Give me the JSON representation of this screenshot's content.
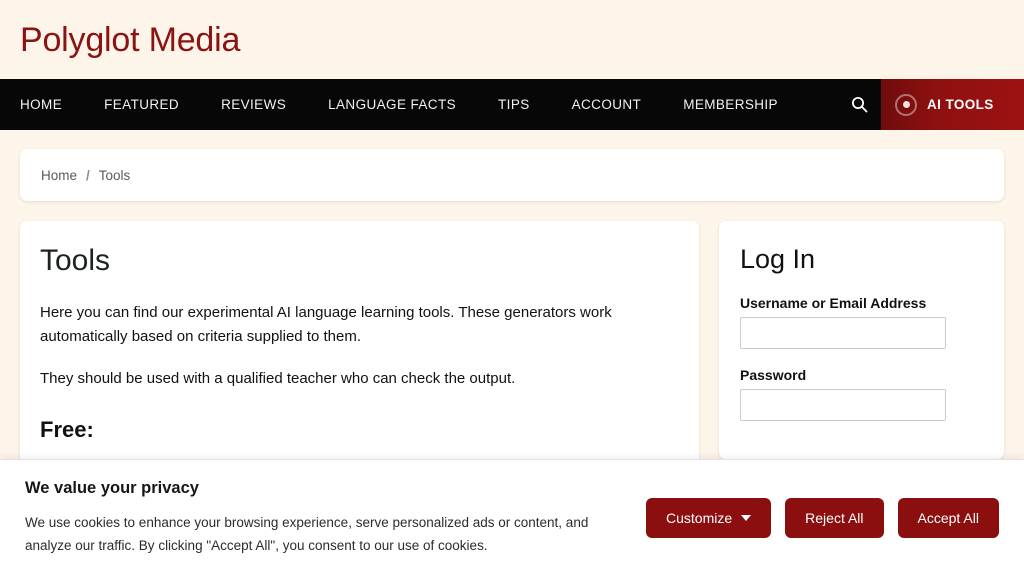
{
  "site": {
    "logo_text": "Polyglot Media",
    "logo_color": "#8b1313",
    "page_background": "#fdf4ea",
    "accent_color": "#8b0f0f"
  },
  "nav": {
    "items": [
      {
        "label": "HOME"
      },
      {
        "label": "FEATURED"
      },
      {
        "label": "REVIEWS"
      },
      {
        "label": "LANGUAGE FACTS"
      },
      {
        "label": "TIPS"
      },
      {
        "label": "ACCOUNT"
      },
      {
        "label": "MEMBERSHIP"
      }
    ],
    "search_icon": "search-icon",
    "ai_tools": {
      "label": "AI TOOLS",
      "icon": "target-dot-icon",
      "background": "#8b0f0f"
    }
  },
  "breadcrumb": {
    "home": "Home",
    "separator": "/",
    "current": "Tools"
  },
  "main": {
    "title": "Tools",
    "paragraph_1": "Here you can find our experimental AI language learning tools. These generators work automatically based on criteria supplied to them.",
    "paragraph_2": "They should be used with a qualified teacher who can check the output.",
    "section_heading": "Free:"
  },
  "login": {
    "title": "Log In",
    "username_label": "Username or Email Address",
    "username_value": "",
    "username_placeholder": "",
    "password_label": "Password",
    "password_value": "",
    "password_placeholder": ""
  },
  "cookie_banner": {
    "title": "We value your privacy",
    "body": "We use cookies to enhance your browsing experience, serve personalized ads or content, and analyze our traffic. By clicking \"Accept All\", you consent to our use of cookies.",
    "customize_label": "Customize",
    "reject_label": "Reject All",
    "accept_label": "Accept All"
  }
}
